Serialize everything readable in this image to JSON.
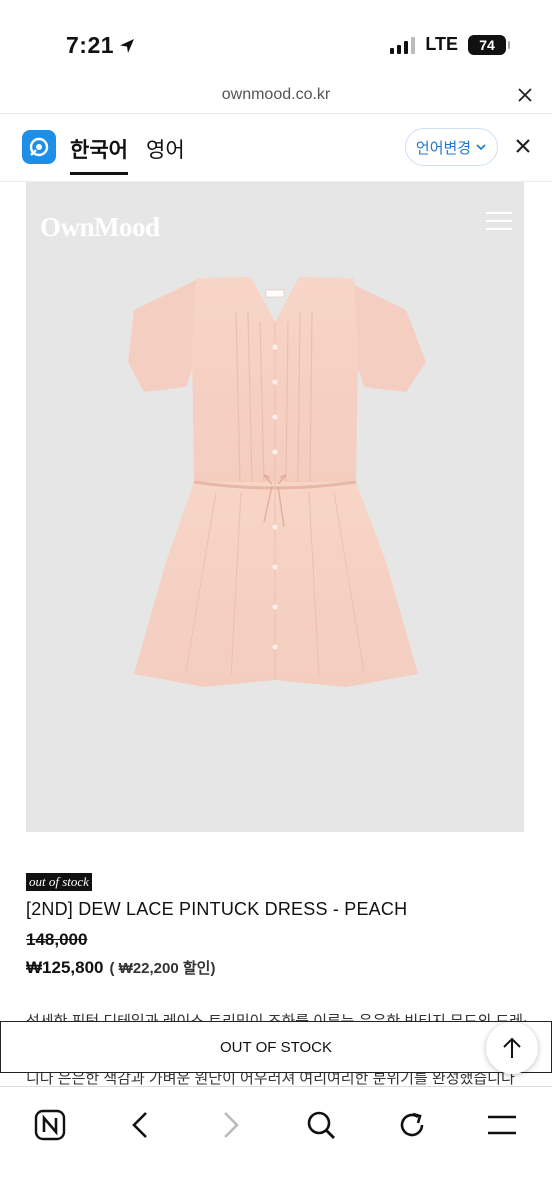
{
  "status_bar": {
    "time": "7:21",
    "network": "LTE",
    "battery": "74"
  },
  "browser": {
    "url": "ownmood.co.kr"
  },
  "translate_bar": {
    "tab_korean": "한국어",
    "tab_english": "영어",
    "change_language": "언어변경"
  },
  "product": {
    "brand": "OwnMood",
    "badge": "out of stock",
    "title": "[2ND] DEW LACE PINTUCK DRESS - PEACH",
    "original_price": "148,000",
    "sale_price": "₩125,800",
    "discount": "( ₩22,200 할인)",
    "description_line1": "섬세한 핀턱 디테일과 레이스 트리밍이 조화를 이루는 은은한 빈티지 무드의 드레스 입",
    "description_line2": "니다 은은한 색감과 가벼운 원단이 어우러져 여리여리한 분위기를 완성했습니다"
  },
  "actions": {
    "out_of_stock": "OUT OF STOCK"
  },
  "colors": {
    "accent_blue": "#1e8fe8",
    "dress_peach": "#f6d3c6",
    "image_bg": "#e6e6e6"
  }
}
